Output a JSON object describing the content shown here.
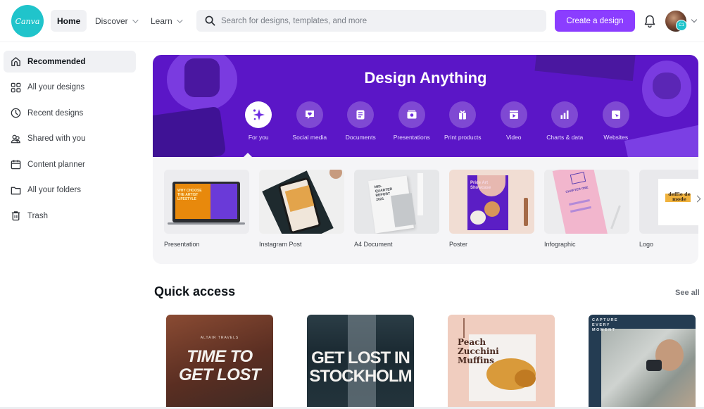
{
  "app": {
    "logo_text": "Canva",
    "brand_color": "#8b3dff",
    "logo_color": "#20c4cb"
  },
  "topnav": {
    "items": [
      {
        "label": "Home",
        "active": true
      },
      {
        "label": "Discover",
        "has_dropdown": true
      },
      {
        "label": "Learn",
        "has_dropdown": true
      }
    ],
    "search_placeholder": "Search for designs, templates, and more",
    "create_button": "Create a design",
    "notification_icon": "bell-icon",
    "avatar_badge": "C1"
  },
  "sidebar": {
    "items": [
      {
        "label": "Recommended",
        "icon": "home-icon",
        "active": true
      },
      {
        "label": "All your designs",
        "icon": "grid-icon"
      },
      {
        "label": "Recent designs",
        "icon": "clock-icon"
      },
      {
        "label": "Shared with you",
        "icon": "people-icon"
      },
      {
        "label": "Content planner",
        "icon": "calendar-icon"
      },
      {
        "label": "All your folders",
        "icon": "folder-icon"
      },
      {
        "label": "Trash",
        "icon": "trash-icon"
      }
    ]
  },
  "hero": {
    "title": "Design Anything",
    "background_color": "#5b16c7",
    "categories": [
      {
        "label": "For you",
        "icon": "sparkle-icon",
        "active": true
      },
      {
        "label": "Social media",
        "icon": "heart-chat-icon"
      },
      {
        "label": "Documents",
        "icon": "document-icon"
      },
      {
        "label": "Presentations",
        "icon": "presentation-icon"
      },
      {
        "label": "Print products",
        "icon": "gift-icon"
      },
      {
        "label": "Video",
        "icon": "video-icon"
      },
      {
        "label": "Charts & data",
        "icon": "bar-chart-icon"
      },
      {
        "label": "Websites",
        "icon": "website-cursor-icon"
      }
    ]
  },
  "templates": {
    "items": [
      {
        "label": "Presentation",
        "thumb_text": "WHY CHOOSE THE ARTIST LIFESTYLE"
      },
      {
        "label": "Instagram Post",
        "thumb_text": ""
      },
      {
        "label": "A4 Document",
        "thumb_text": "MID-QUARTER REPORT 2021"
      },
      {
        "label": "Poster",
        "thumb_text": "Pride Art Showcase"
      },
      {
        "label": "Infographic",
        "thumb_text": "CHAPTER ONE"
      },
      {
        "label": "Logo",
        "thumb_text": "deffie de mode"
      }
    ]
  },
  "quick_access": {
    "title": "Quick access",
    "see_all": "See all",
    "items": [
      {
        "subtitle": "ALTAIR TRAVELS",
        "title_line1": "TIME TO",
        "title_line2": "GET LOST",
        "bg": "#6b3a2a"
      },
      {
        "subtitle": "",
        "title_line1": "GET LOST IN",
        "title_line2": "STOCKHOLM",
        "bg": "#1f2f38"
      },
      {
        "subtitle": "",
        "title_line1": "Peach",
        "title_line2": "Zucchini",
        "title_line3": "Muffins",
        "bg": "#f0cdbf"
      },
      {
        "subtitle": "",
        "title_line1": "CAPTURE",
        "title_line2": "EVERY",
        "title_line3": "MOMENT",
        "bg": "#243c52"
      }
    ]
  }
}
